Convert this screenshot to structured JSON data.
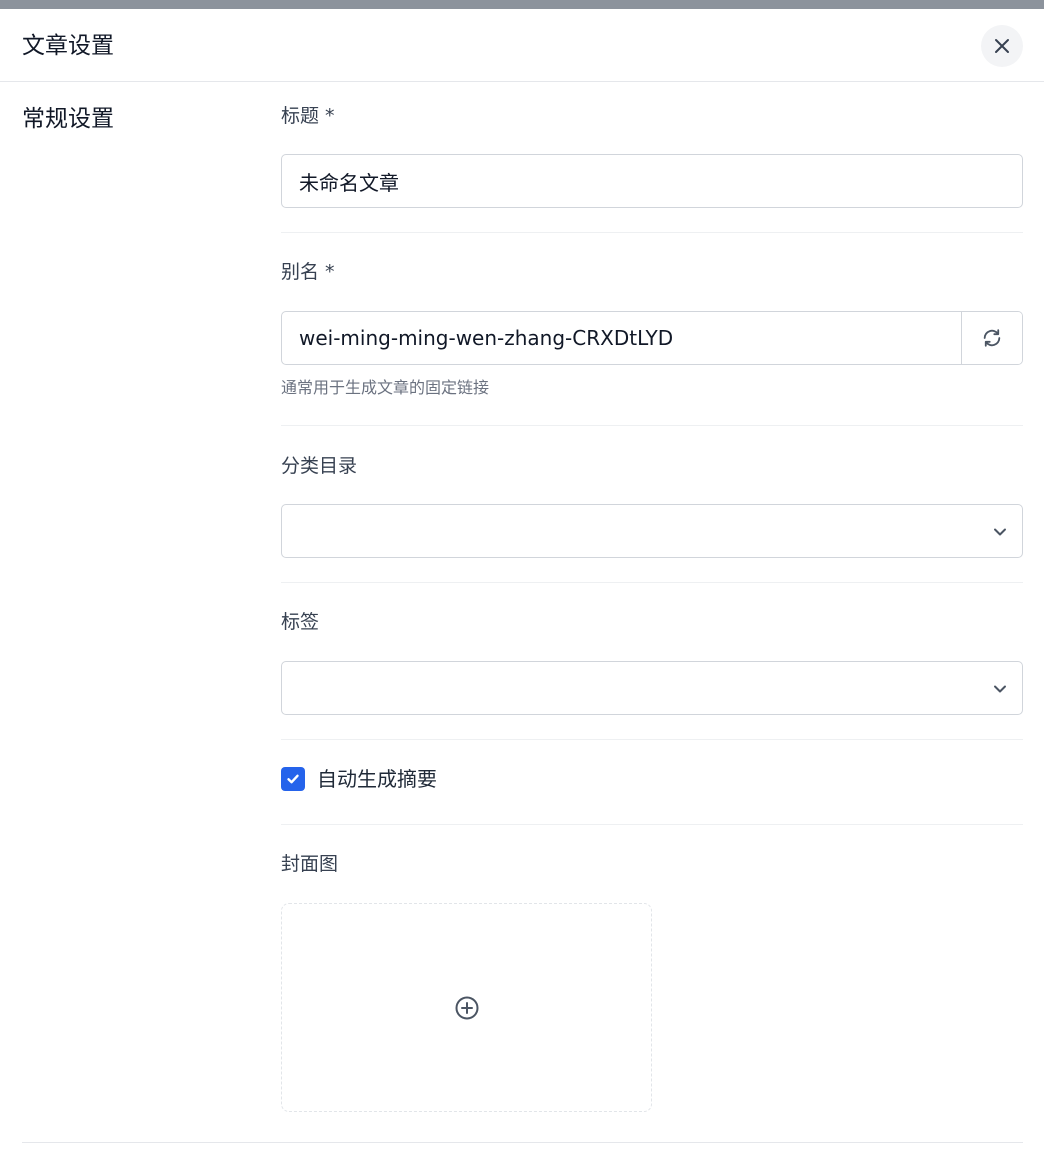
{
  "header": {
    "title": "文章设置"
  },
  "sidebar": {
    "section_title": "常规设置"
  },
  "form": {
    "title_field": {
      "label": "标题 *",
      "value": "未命名文章"
    },
    "slug_field": {
      "label": "别名 *",
      "value": "wei-ming-ming-wen-zhang-CRXDtLYD",
      "help": "通常用于生成文章的固定链接"
    },
    "category_field": {
      "label": "分类目录",
      "value": ""
    },
    "tags_field": {
      "label": "标签",
      "value": ""
    },
    "auto_excerpt": {
      "label": "自动生成摘要",
      "checked": true
    },
    "cover_field": {
      "label": "封面图"
    }
  },
  "icons": {
    "close": "close-icon",
    "refresh": "refresh-icon",
    "chevron": "chevron-down-icon",
    "check": "check-icon",
    "add": "plus-circle-icon"
  },
  "colors": {
    "accent": "#2563eb",
    "border": "#d1d5db",
    "top_strip": "#8c939c"
  }
}
